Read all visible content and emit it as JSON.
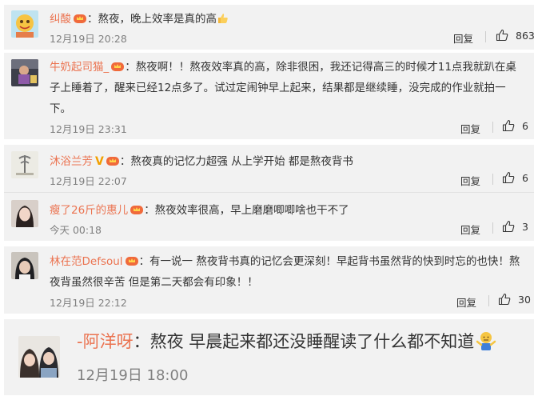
{
  "comments": [
    {
      "username": "纠酸",
      "text_lines": [
        "：熬夜，晚上效率是真的高"
      ],
      "emoji": "thumbs-up-emoji",
      "time": "12月19日 20:28",
      "reply_label": "回复",
      "likes": "863"
    },
    {
      "username": "牛奶起司猫_",
      "text_lines": [
        "：熬夜啊！！熬夜效率真的高，除非很困，我还记得高三的时候才11点我就趴在桌",
        "子上睡着了，醒来已经12点多了。试过定闹钟早上起来，结果都是继续睡，没完成的作业就拍一",
        "下。"
      ],
      "time": "12月19日 23:31",
      "reply_label": "回复",
      "likes": "6"
    },
    {
      "username": "沐浴兰芳",
      "verified_badge": "V",
      "text_lines": [
        "：熬夜真的记忆力超强 从上学开始 都是熬夜背书"
      ],
      "time": "12月19日 22:07",
      "reply_label": "回复",
      "likes": "6"
    },
    {
      "username": "瘦了26斤的惠儿",
      "text_lines": [
        "：熬夜效率很高，早上磨磨唧唧啥也干不了"
      ],
      "time": "今天 00:18",
      "reply_label": "回复",
      "likes": "3"
    },
    {
      "username": "林在范Defsoul",
      "text_lines": [
        "：有一说一 熬夜背书真的记忆会更深刻！早起背书虽然背的快到时忘的也快！熬",
        "夜背虽然很辛苦 但是第二天都会有印象！！"
      ],
      "time": "12月19日 22:12",
      "reply_label": "回复",
      "likes": "30"
    },
    {
      "username": "-阿洋呀",
      "text_lines": [
        "：熬夜  早晨起来都还没睡醒读了什么都不知道"
      ],
      "emoji": "shrug-emoji",
      "time": "12月19日 18:00"
    }
  ],
  "colors": {
    "username": "#eb7350",
    "text": "#333333",
    "timestamp": "#808080",
    "card_bg": "#f2f2f2",
    "vip_badge": "#f2a000"
  }
}
